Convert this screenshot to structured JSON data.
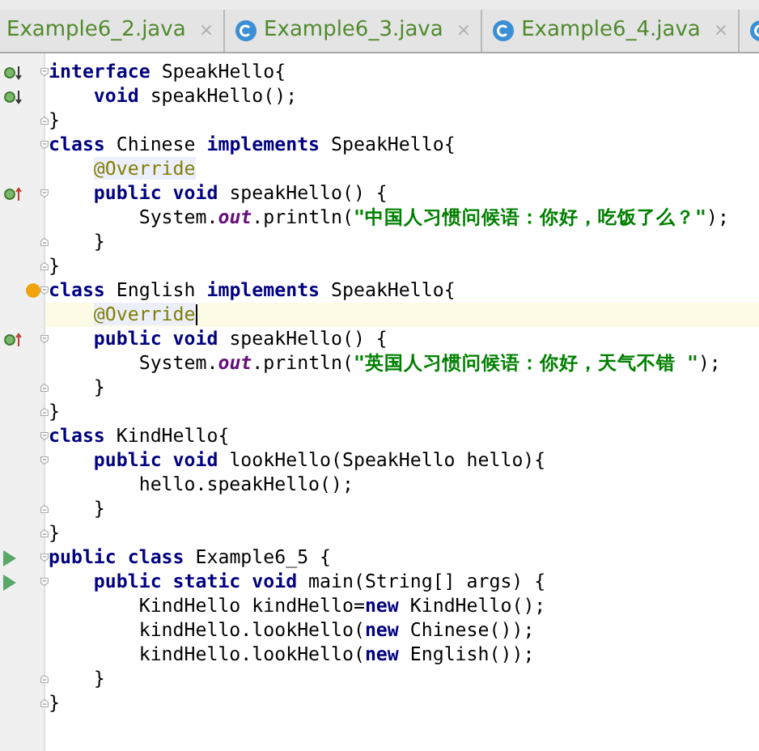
{
  "tabs": [
    {
      "label": "Example6_2.java",
      "close": "×",
      "selected": false,
      "icon": false
    },
    {
      "label": "Example6_3.java",
      "close": "×",
      "selected": false,
      "icon": true
    },
    {
      "label": "Example6_4.java",
      "close": "×",
      "selected": false,
      "icon": true
    },
    {
      "selected": false,
      "icon": true
    }
  ],
  "lines": [
    {
      "implemented": true,
      "fold_start": true,
      "tokens": [
        {
          "kind": "keyword",
          "text": "interface"
        },
        {
          "kind": "plain",
          "text": " SpeakHello{"
        }
      ]
    },
    {
      "implemented": true,
      "tokens": [
        {
          "kind": "keyword",
          "text": "    void"
        },
        {
          "kind": "plain",
          "text": " speakHello();"
        }
      ]
    },
    {
      "fold_end": true,
      "tokens": [
        {
          "kind": "plain",
          "text": "}"
        }
      ]
    },
    {
      "fold_start": true,
      "tokens": [
        {
          "kind": "keyword",
          "text": "class"
        },
        {
          "kind": "plain",
          "text": " Chinese "
        },
        {
          "kind": "keyword",
          "text": "implements"
        },
        {
          "kind": "plain",
          "text": " SpeakHello{"
        }
      ]
    },
    {
      "tokens": [
        {
          "kind": "annotation",
          "text": "    @Override"
        }
      ]
    },
    {
      "overrides": true,
      "fold_start": true,
      "tokens": [
        {
          "kind": "keyword",
          "text": "    public void"
        },
        {
          "kind": "plain",
          "text": " speakHello() {"
        }
      ]
    },
    {
      "tokens": [
        {
          "kind": "plain",
          "text": "        System."
        },
        {
          "kind": "field",
          "text": "out"
        },
        {
          "kind": "plain",
          "text": ".println("
        },
        {
          "kind": "string",
          "text": "\"中国人习惯问候语：你好，吃饭了么？\""
        },
        {
          "kind": "plain",
          "text": ");"
        }
      ]
    },
    {
      "fold_end": true,
      "tokens": [
        {
          "kind": "plain",
          "text": "    }"
        }
      ]
    },
    {
      "fold_end": true,
      "tokens": [
        {
          "kind": "plain",
          "text": "}"
        }
      ]
    },
    {
      "fold_start": true,
      "bulb": true,
      "tokens": [
        {
          "kind": "keyword",
          "text": "class"
        },
        {
          "kind": "plain",
          "text": " English "
        },
        {
          "kind": "keyword",
          "text": "implements"
        },
        {
          "kind": "plain",
          "text": " SpeakHello{"
        }
      ]
    },
    {
      "current": true,
      "tokens": [
        {
          "kind": "annotation",
          "text": "    @Override"
        }
      ]
    },
    {
      "overrides": true,
      "fold_start": true,
      "tokens": [
        {
          "kind": "keyword",
          "text": "    public void"
        },
        {
          "kind": "plain",
          "text": " speakHello() {"
        }
      ]
    },
    {
      "tokens": [
        {
          "kind": "plain",
          "text": "        System."
        },
        {
          "kind": "field",
          "text": "out"
        },
        {
          "kind": "plain",
          "text": ".println("
        },
        {
          "kind": "string",
          "text": "\"英国人习惯问候语：你好，天气不错 \""
        },
        {
          "kind": "plain",
          "text": ");"
        }
      ]
    },
    {
      "fold_end": true,
      "tokens": [
        {
          "kind": "plain",
          "text": "    }"
        }
      ]
    },
    {
      "fold_end": true,
      "tokens": [
        {
          "kind": "plain",
          "text": "}"
        }
      ]
    },
    {
      "fold_start": true,
      "tokens": [
        {
          "kind": "keyword",
          "text": "class"
        },
        {
          "kind": "plain",
          "text": " KindHello{"
        }
      ]
    },
    {
      "fold_start": true,
      "tokens": [
        {
          "kind": "keyword",
          "text": "    public void"
        },
        {
          "kind": "plain",
          "text": " lookHello(SpeakHello hello){"
        }
      ]
    },
    {
      "tokens": [
        {
          "kind": "plain",
          "text": "        hello.speakHello();"
        }
      ]
    },
    {
      "fold_end": true,
      "tokens": [
        {
          "kind": "plain",
          "text": "    }"
        }
      ]
    },
    {
      "fold_end": true,
      "tokens": [
        {
          "kind": "plain",
          "text": "}"
        }
      ]
    },
    {
      "runnable": true,
      "fold_start": true,
      "tokens": [
        {
          "kind": "keyword",
          "text": "public class"
        },
        {
          "kind": "plain",
          "text": " Example6_5 {"
        }
      ]
    },
    {
      "runnable": true,
      "fold_start": true,
      "tokens": [
        {
          "kind": "keyword",
          "text": "    public static void"
        },
        {
          "kind": "plain",
          "text": " main(String[] args) {"
        }
      ]
    },
    {
      "tokens": [
        {
          "kind": "plain",
          "text": "        KindHello kindHello="
        },
        {
          "kind": "keyword",
          "text": "new"
        },
        {
          "kind": "plain",
          "text": " KindHello();"
        }
      ]
    },
    {
      "tokens": [
        {
          "kind": "plain",
          "text": "        kindHello.lookHello("
        },
        {
          "kind": "keyword",
          "text": "new"
        },
        {
          "kind": "plain",
          "text": " Chinese());"
        }
      ]
    },
    {
      "tokens": [
        {
          "kind": "plain",
          "text": "        kindHello.lookHello("
        },
        {
          "kind": "keyword",
          "text": "new"
        },
        {
          "kind": "plain",
          "text": " English());"
        }
      ]
    },
    {
      "fold_end": true,
      "tokens": [
        {
          "kind": "plain",
          "text": "    }"
        }
      ]
    },
    {
      "fold_end": true,
      "tokens": [
        {
          "kind": "plain",
          "text": "}"
        }
      ]
    }
  ]
}
